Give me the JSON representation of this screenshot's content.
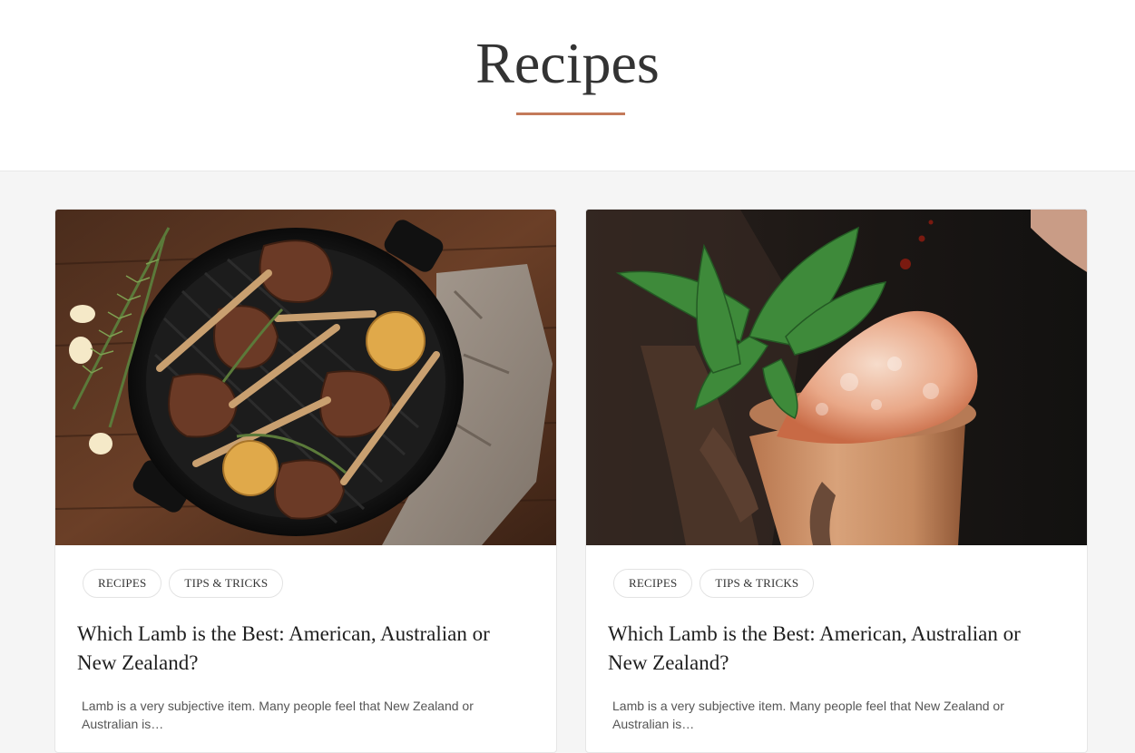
{
  "page": {
    "title": "Recipes",
    "accent_color": "#c47a5a"
  },
  "cards": [
    {
      "image_subject": "grilled lamb chops in cast iron pan with rosemary and garlic",
      "tags": [
        "RECIPES",
        "TIPS & TRICKS"
      ],
      "title": "Which Lamb is the Best: American, Australian or New Zealand?",
      "excerpt": "Lamb is a very subjective item. Many people feel that New Zealand or Australian is…"
    },
    {
      "image_subject": "copper mug cocktail with crushed ice and mint garnish",
      "tags": [
        "RECIPES",
        "TIPS & TRICKS"
      ],
      "title": "Which Lamb is the Best: American, Australian or New Zealand?",
      "excerpt": "Lamb is a very subjective item. Many people feel that New Zealand or Australian is…"
    }
  ]
}
